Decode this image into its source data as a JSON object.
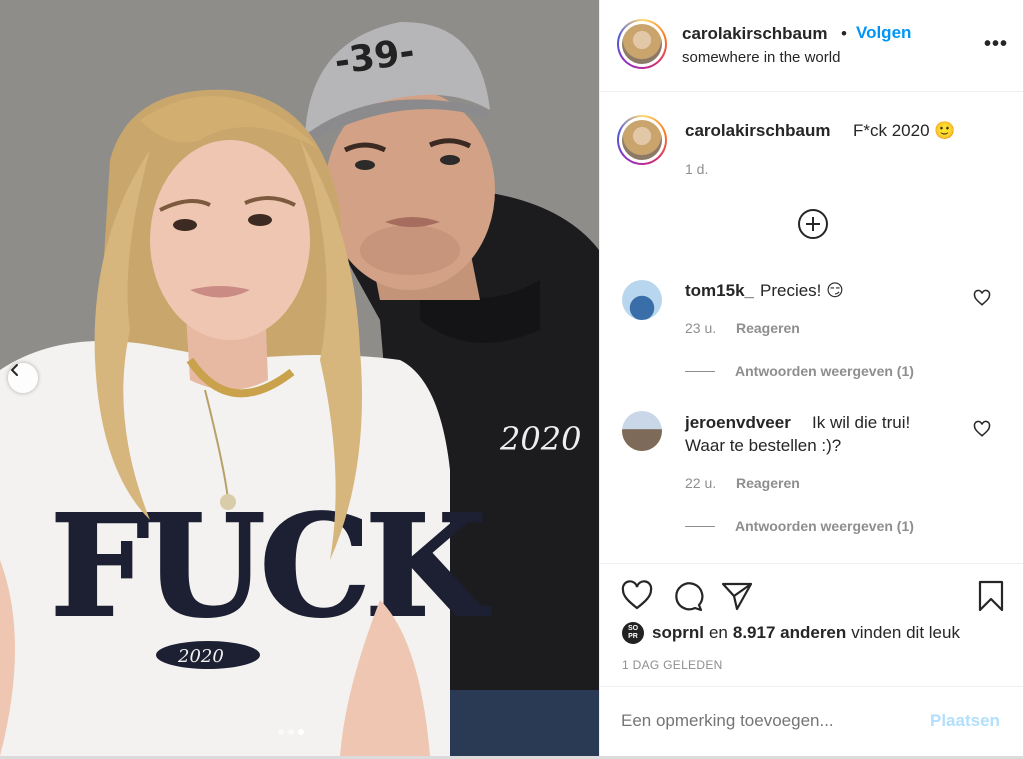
{
  "post": {
    "username": "carolakirschbaum",
    "follow_label": "Volgen",
    "bullet": "•",
    "location": "somewhere in the world",
    "more_label": "•••"
  },
  "caption": {
    "username": "carolakirschbaum",
    "text": "F*ck 2020 🙂",
    "time": "1 d."
  },
  "comments": [
    {
      "username": "tom15k_",
      "text": "Precies! 😏",
      "time": "23 u.",
      "reply_label": "Reageren",
      "view_replies": "Antwoorden weergeven (1)"
    },
    {
      "username": "jeroenvdveer",
      "text_line1": "Ik wil die trui!",
      "text_line2": "Waar te bestellen :)?",
      "time": "22 u.",
      "reply_label": "Reageren",
      "view_replies": "Antwoorden weergeven (1)"
    }
  ],
  "likes": {
    "avatar_text_top": "SO",
    "avatar_text_bottom": "PR",
    "liker": "soprnl",
    "connector": "en",
    "count": "8.917 anderen",
    "suffix": "vinden dit leuk"
  },
  "date_label": "1 DAG GELEDEN",
  "comment_box": {
    "placeholder": "Een opmerking toevoegen...",
    "post_label": "Plaatsen"
  },
  "carousel": {
    "slides": 3,
    "active": 3
  },
  "colors": {
    "accent": "#0095f6",
    "muted": "#8e8e8e",
    "post_disabled": "#b2dffc"
  }
}
